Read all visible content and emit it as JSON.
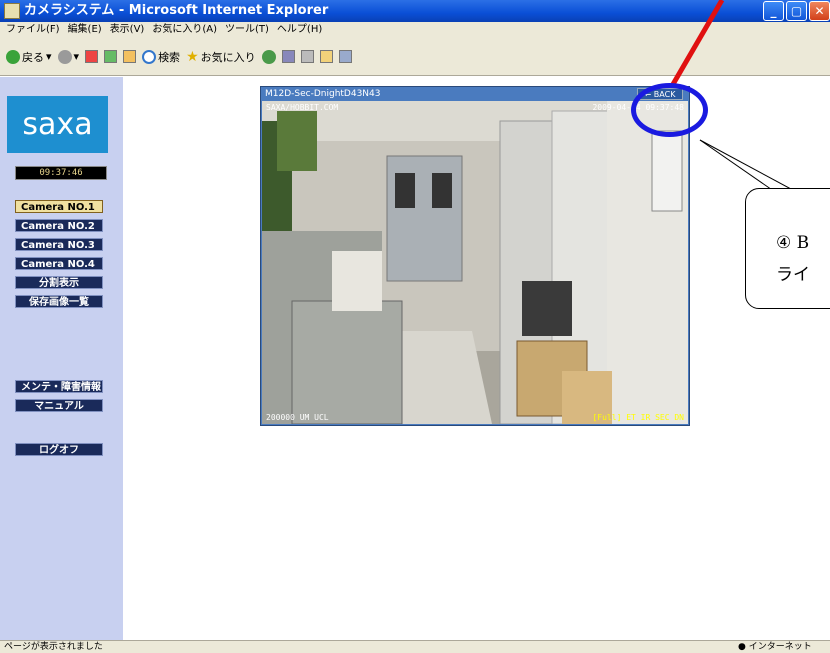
{
  "window": {
    "title": "カメラシステム - Microsoft Internet Explorer"
  },
  "menu": [
    "ファイル(F)",
    "編集(E)",
    "表示(V)",
    "お気に入り(A)",
    "ツール(T)",
    "ヘルプ(H)"
  ],
  "toolbar": {
    "back": "戻る",
    "search": "検索",
    "favorites": "お気に入り"
  },
  "sidebar": {
    "logo": "saxa",
    "clock": "09:37:46",
    "buttons": [
      "Camera NO.1",
      "Camera NO.2",
      "Camera NO.3",
      "Camera NO.4",
      "分割表示",
      "保存画像一覧",
      "メンテ・障害情報",
      "マニュアル",
      "ログオフ"
    ]
  },
  "viewer": {
    "title": "M12D-Sec-DnightD43N43",
    "back": "← BACK",
    "overlay_top_left": "SAXA/HOBBIT.COM",
    "overlay_top_right": "2009-04-24 09:37:48",
    "overlay_bottom_left": "200000 UM UCL",
    "overlay_bottom_right": "[Full] ET IR SEC DN"
  },
  "callout": {
    "line1": "④ B",
    "line2": "ライ"
  },
  "statusbar": {
    "text": "ページが表示されました",
    "zone": "インターネット"
  },
  "colors": {
    "annotation_circle": "#1a1ae0",
    "annotation_arrow": "#e01010",
    "sidebar_bg": "#c8d0f0"
  }
}
